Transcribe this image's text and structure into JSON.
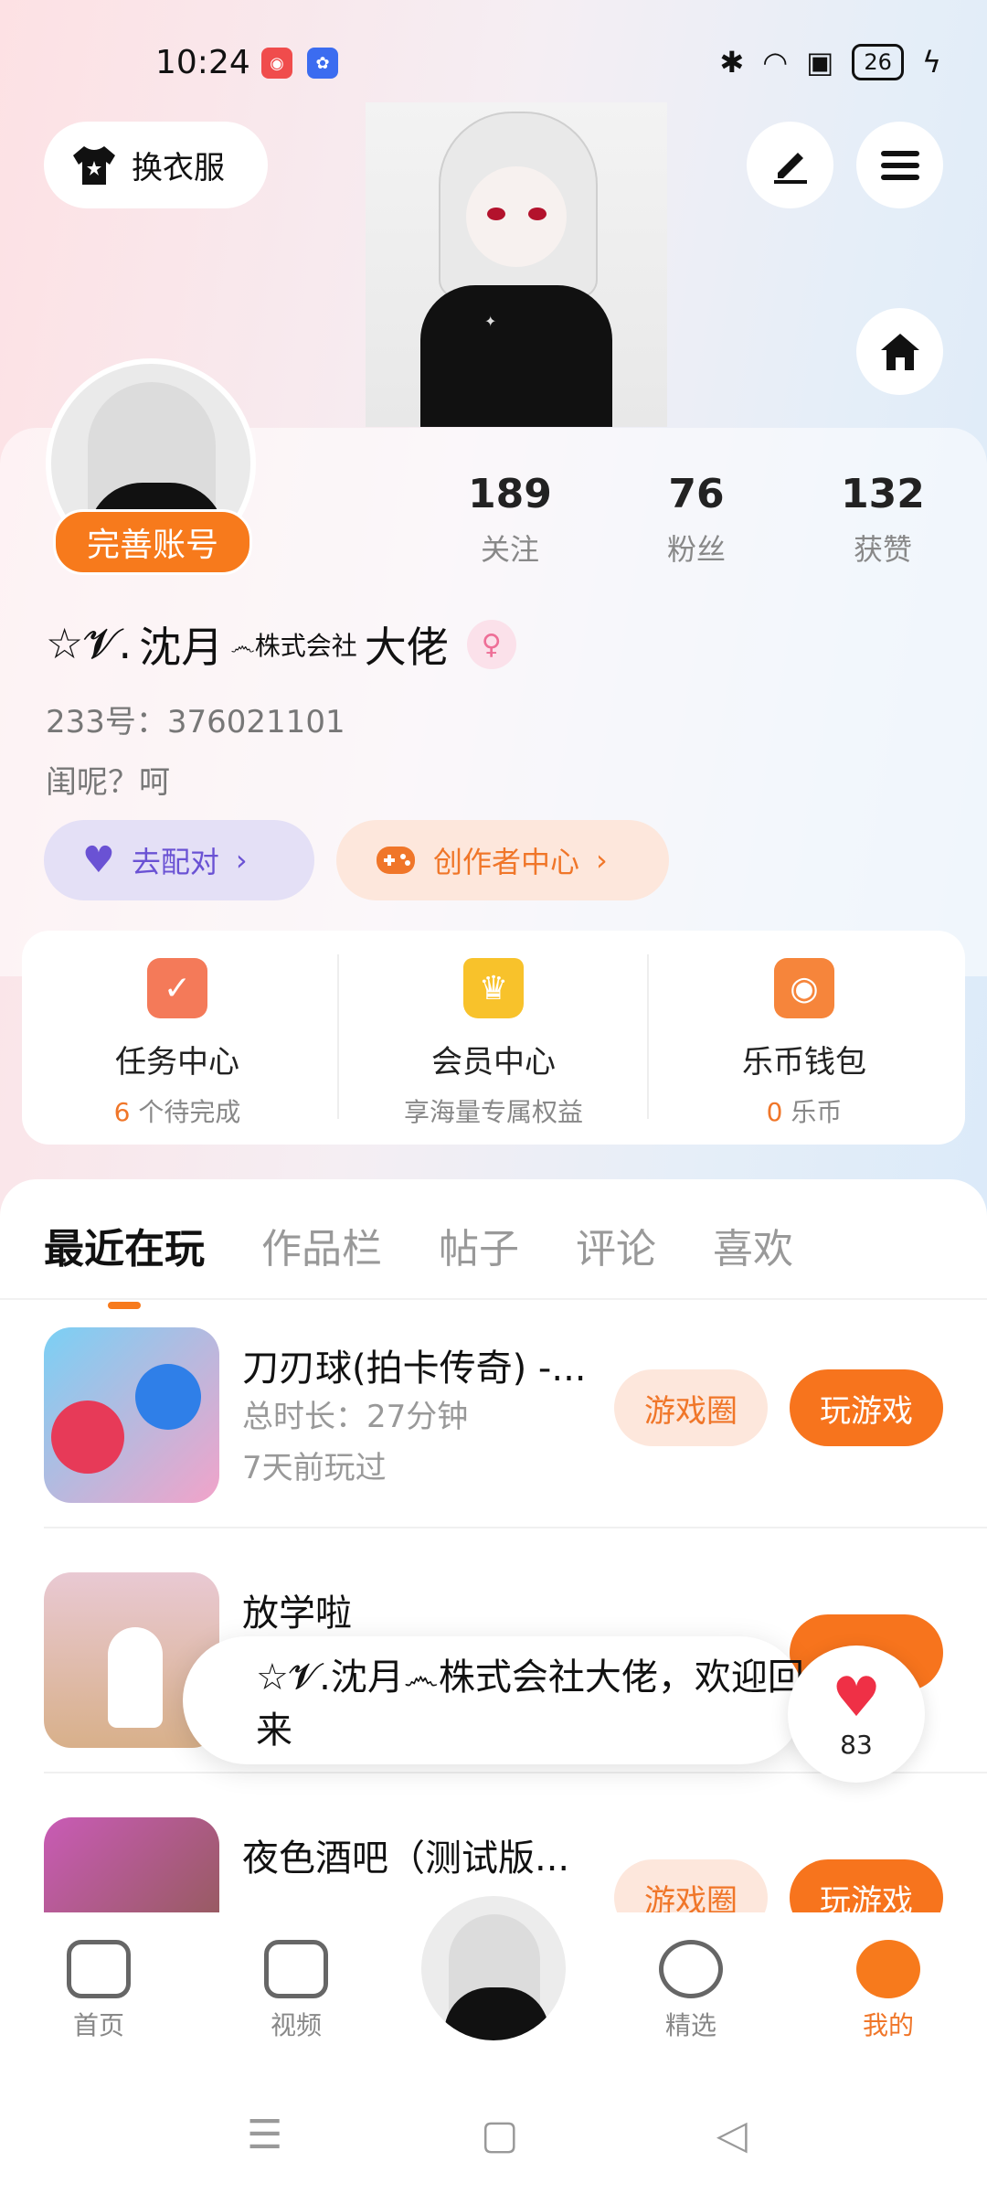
{
  "status": {
    "time": "10:24",
    "battery": "26"
  },
  "header": {
    "outfit_label": "换衣服"
  },
  "profile": {
    "complete_label": "完善账号",
    "stats": [
      {
        "num": "189",
        "label": "关注"
      },
      {
        "num": "76",
        "label": "粉丝"
      },
      {
        "num": "132",
        "label": "获赞"
      }
    ],
    "name_prefix": "☆𝓥.",
    "name": "沈月",
    "name_mid": "෴株式会社",
    "name_suffix": "大佬",
    "id_text": "233号：376021101",
    "bio": "闺呢？呵",
    "pair_label": "去配对",
    "creator_label": "创作者中心"
  },
  "tasks": [
    {
      "title": "任务中心",
      "count": "6",
      "sub": " 个待完成"
    },
    {
      "title": "会员中心",
      "count": "",
      "sub": "享海量专属权益"
    },
    {
      "title": "乐币钱包",
      "count": "0",
      "sub": " 乐币"
    }
  ],
  "tabs": [
    "最近在玩",
    "作品栏",
    "帖子",
    "评论",
    "喜欢"
  ],
  "games": [
    {
      "title": "刀刃球(拍卡传奇) -...",
      "line1": "总时长：27分钟",
      "line2": "7天前玩过",
      "btn1": "游戏圈",
      "btn2": "玩游戏"
    },
    {
      "title": "放学啦",
      "line1": "",
      "line2": "",
      "btn1": "",
      "btn2": ""
    },
    {
      "title": "夜色酒吧（测试版...",
      "line1": "",
      "line2": "",
      "btn1": "游戏圈",
      "btn2": "玩游戏"
    }
  ],
  "toast": {
    "text": "☆𝓥.沈月෴株式会社大佬，欢迎回来"
  },
  "likes": {
    "count": "83"
  },
  "nav": [
    {
      "label": "首页"
    },
    {
      "label": "视频"
    },
    {
      "label": "精选"
    },
    {
      "label": "我的"
    }
  ],
  "colors": {
    "accent": "#f77a1c",
    "purple": "#6a52d4",
    "heart": "#ef3046"
  }
}
